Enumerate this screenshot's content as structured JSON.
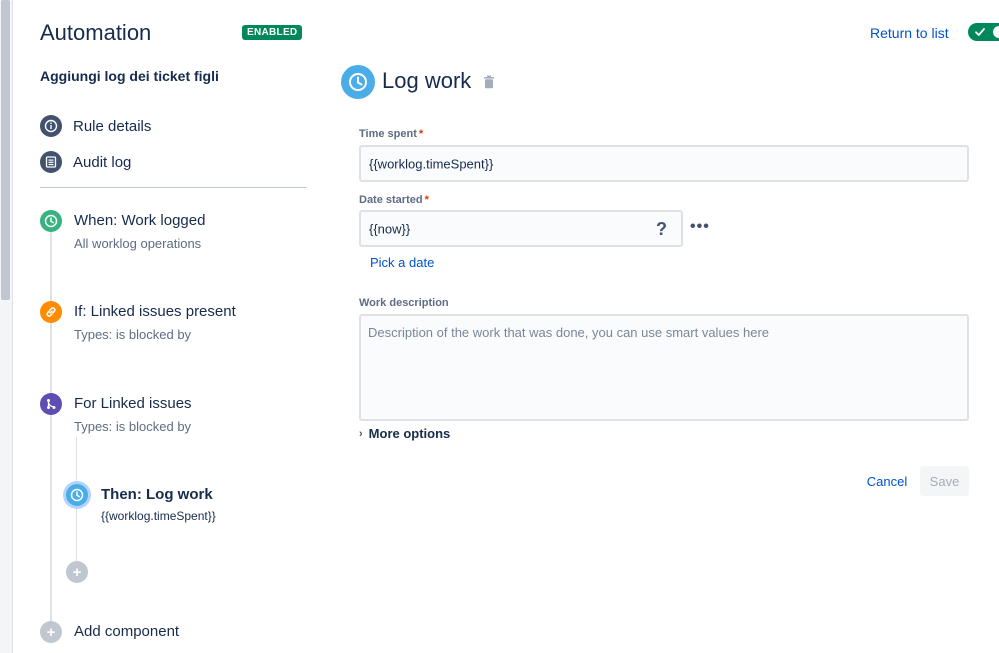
{
  "header": {
    "app_title": "Automation",
    "status_badge": "ENABLED",
    "return_link": "Return to list",
    "toggle_enabled": true
  },
  "sidebar": {
    "rule_name": "Aggiungi log dei ticket figli",
    "links": [
      {
        "label": "Rule details",
        "icon": "info-icon"
      },
      {
        "label": "Audit log",
        "icon": "list-icon"
      }
    ],
    "steps": [
      {
        "title": "When: Work logged",
        "subtitle": "All worklog operations",
        "icon": "clock-icon",
        "color": "#36b37e"
      },
      {
        "title": "If: Linked issues present",
        "subtitle": "Types: is blocked by",
        "icon": "link-icon",
        "color": "#ff8b00"
      },
      {
        "title": "For Linked issues",
        "subtitle": "Types: is blocked by",
        "icon": "branch-icon",
        "color": "#5e4db2"
      }
    ],
    "sub_step": {
      "title": "Then: Log work",
      "subtitle": "{{worklog.timeSpent}}",
      "icon": "clock-icon",
      "color": "#4bade8"
    },
    "add_component": "Add component"
  },
  "main": {
    "title": "Log work",
    "time_spent_label": "Time spent",
    "time_spent_value": "{{worklog.timeSpent}}",
    "date_started_label": "Date started",
    "date_started_value": "{{now}}",
    "help_glyph": "?",
    "more_glyph": "•••",
    "pick_date": "Pick a date",
    "work_description_label": "Work description",
    "work_description_placeholder": "Description of the work that was done, you can use smart values here",
    "more_options": "More options",
    "cancel": "Cancel",
    "save": "Save"
  }
}
